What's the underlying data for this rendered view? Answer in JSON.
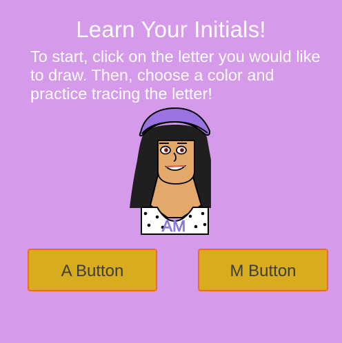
{
  "page": {
    "title": "Learn Your Initials!",
    "instructions": "To start, click on the letter you would like to draw. Then, choose a color and practice tracing the letter!"
  },
  "avatar": {
    "shirt_text": "AM"
  },
  "buttons": {
    "a_label": "A Button",
    "m_label": "M Button"
  },
  "colors": {
    "background": "#d59aea",
    "button_fill": "#d8ac1f",
    "button_border": "#f06b22",
    "title_text": "#ffffff"
  }
}
